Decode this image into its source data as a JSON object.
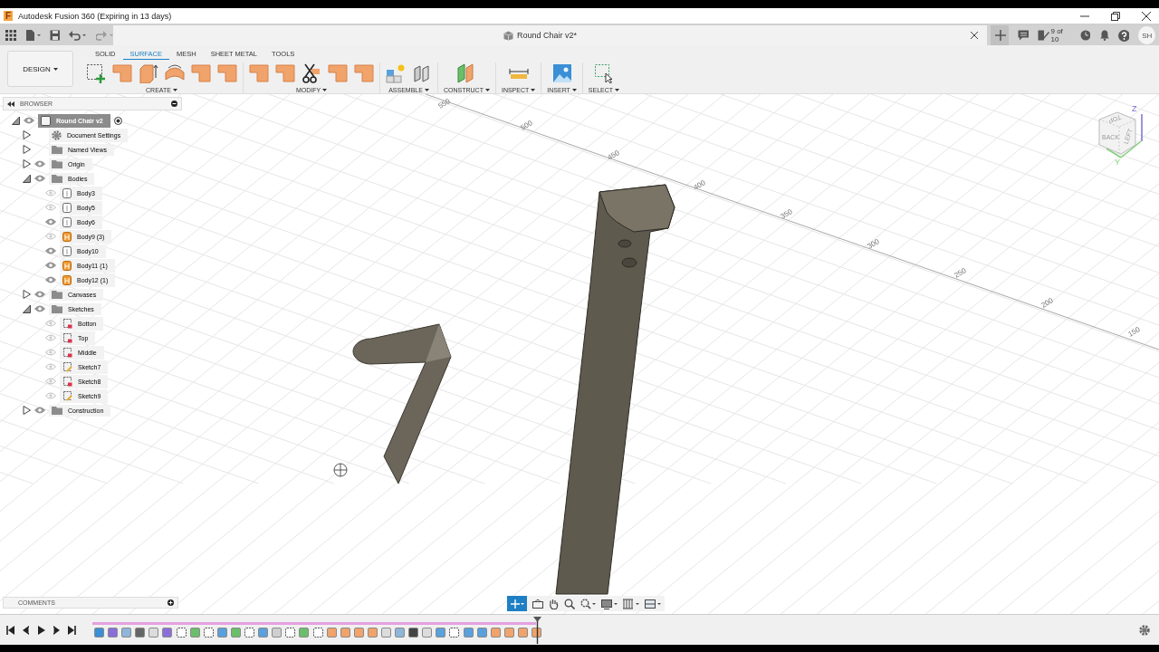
{
  "window": {
    "title": "Autodesk Fusion 360 (Expiring in 13 days)",
    "app_letter": "F"
  },
  "document_tab": {
    "title": "Round Chair v2*"
  },
  "header": {
    "job_status": "9 of 10",
    "user_initials": "SH"
  },
  "workspace": {
    "label": "DESIGN"
  },
  "ribbon_tabs": [
    {
      "label": "SOLID",
      "selected": false
    },
    {
      "label": "SURFACE",
      "selected": true
    },
    {
      "label": "MESH",
      "selected": false
    },
    {
      "label": "SHEET METAL",
      "selected": false
    },
    {
      "label": "TOOLS",
      "selected": false
    }
  ],
  "ribbon_groups": [
    {
      "label": "CREATE"
    },
    {
      "label": "MODIFY"
    },
    {
      "label": "ASSEMBLE"
    },
    {
      "label": "CONSTRUCT"
    },
    {
      "label": "INSPECT"
    },
    {
      "label": "INSERT"
    },
    {
      "label": "SELECT"
    }
  ],
  "browser": {
    "title": "BROWSER",
    "tree": {
      "label": "Round Chair v2",
      "kind": "component",
      "selected": true,
      "visible": true,
      "expanded": true,
      "children": [
        {
          "label": "Document Settings",
          "kind": "settings",
          "selected": false,
          "expanded": false
        },
        {
          "label": "Named Views",
          "kind": "folder",
          "selected": false,
          "expanded": false
        },
        {
          "label": "Origin",
          "kind": "folder",
          "selected": false,
          "visible": true,
          "expanded": false
        },
        {
          "label": "Bodies",
          "kind": "folder",
          "selected": false,
          "visible": true,
          "expanded": true,
          "children": [
            {
              "label": "Body3",
              "kind": "body",
              "selected": false,
              "visible": false
            },
            {
              "label": "Body5",
              "kind": "body",
              "selected": false,
              "visible": false
            },
            {
              "label": "Body6",
              "kind": "body",
              "selected": false,
              "visible": true
            },
            {
              "label": "Body9 (3)",
              "kind": "orange-body",
              "selected": false,
              "visible": false
            },
            {
              "label": "Body10",
              "kind": "body",
              "selected": false,
              "visible": true
            },
            {
              "label": "Body11 (1)",
              "kind": "orange-body",
              "selected": false,
              "visible": true
            },
            {
              "label": "Body12 (1)",
              "kind": "orange-body",
              "selected": false,
              "visible": true
            }
          ]
        },
        {
          "label": "Canvases",
          "kind": "folder",
          "selected": false,
          "visible": true,
          "expanded": false
        },
        {
          "label": "Sketches",
          "kind": "folder",
          "selected": false,
          "visible": true,
          "expanded": true,
          "children": [
            {
              "label": "Botton",
              "kind": "locked-sketch",
              "selected": false,
              "visible": false
            },
            {
              "label": "Top",
              "kind": "locked-sketch",
              "selected": false,
              "visible": false
            },
            {
              "label": "Middle",
              "kind": "locked-sketch",
              "selected": false,
              "visible": false
            },
            {
              "label": "Sketch7",
              "kind": "sketch",
              "selected": false,
              "visible": false
            },
            {
              "label": "Sketch8",
              "kind": "locked-sketch",
              "selected": false,
              "visible": false
            },
            {
              "label": "Sketch9",
              "kind": "sketch",
              "selected": false,
              "visible": false
            }
          ]
        },
        {
          "label": "Construction",
          "kind": "folder",
          "selected": false,
          "visible": true,
          "expanded": false
        }
      ]
    }
  },
  "viewport": {
    "axis_labels": [
      "550",
      "500",
      "450",
      "400",
      "350",
      "300",
      "250",
      "200",
      "150"
    ],
    "view_cube": {
      "faces": [
        "TOP",
        "BACK",
        "LEFT"
      ],
      "axes": [
        "Z",
        "Y"
      ]
    }
  },
  "comments": {
    "title": "COMMENTS"
  }
}
